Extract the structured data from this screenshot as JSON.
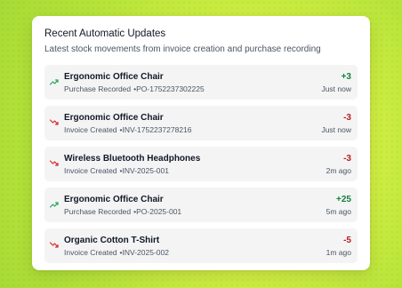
{
  "card": {
    "title": "Recent Automatic Updates",
    "subtitle": "Latest stock movements from invoice creation and purchase recording"
  },
  "colors": {
    "increase": "#15803d",
    "decrease": "#b91c1c",
    "increase_icon": "#22a35a",
    "decrease_icon": "#dc2626"
  },
  "updates": [
    {
      "name": "Ergonomic Office Chair",
      "type": "Purchase Recorded",
      "reference": "PO-1752237302225",
      "delta": "+3",
      "time": "Just now",
      "direction": "up",
      "icon": "trending-up-icon"
    },
    {
      "name": "Ergonomic Office Chair",
      "type": "Invoice Created",
      "reference": "INV-1752237278216",
      "delta": "-3",
      "time": "Just now",
      "direction": "down",
      "icon": "trending-down-icon"
    },
    {
      "name": "Wireless Bluetooth Headphones",
      "type": "Invoice Created",
      "reference": "INV-2025-001",
      "delta": "-3",
      "time": "2m ago",
      "direction": "down",
      "icon": "trending-down-icon"
    },
    {
      "name": "Ergonomic Office Chair",
      "type": "Purchase Recorded",
      "reference": "PO-2025-001",
      "delta": "+25",
      "time": "5m ago",
      "direction": "up",
      "icon": "trending-up-icon"
    },
    {
      "name": "Organic Cotton T-Shirt",
      "type": "Invoice Created",
      "reference": "INV-2025-002",
      "delta": "-5",
      "time": "1m ago",
      "direction": "down",
      "icon": "trending-down-icon"
    }
  ]
}
